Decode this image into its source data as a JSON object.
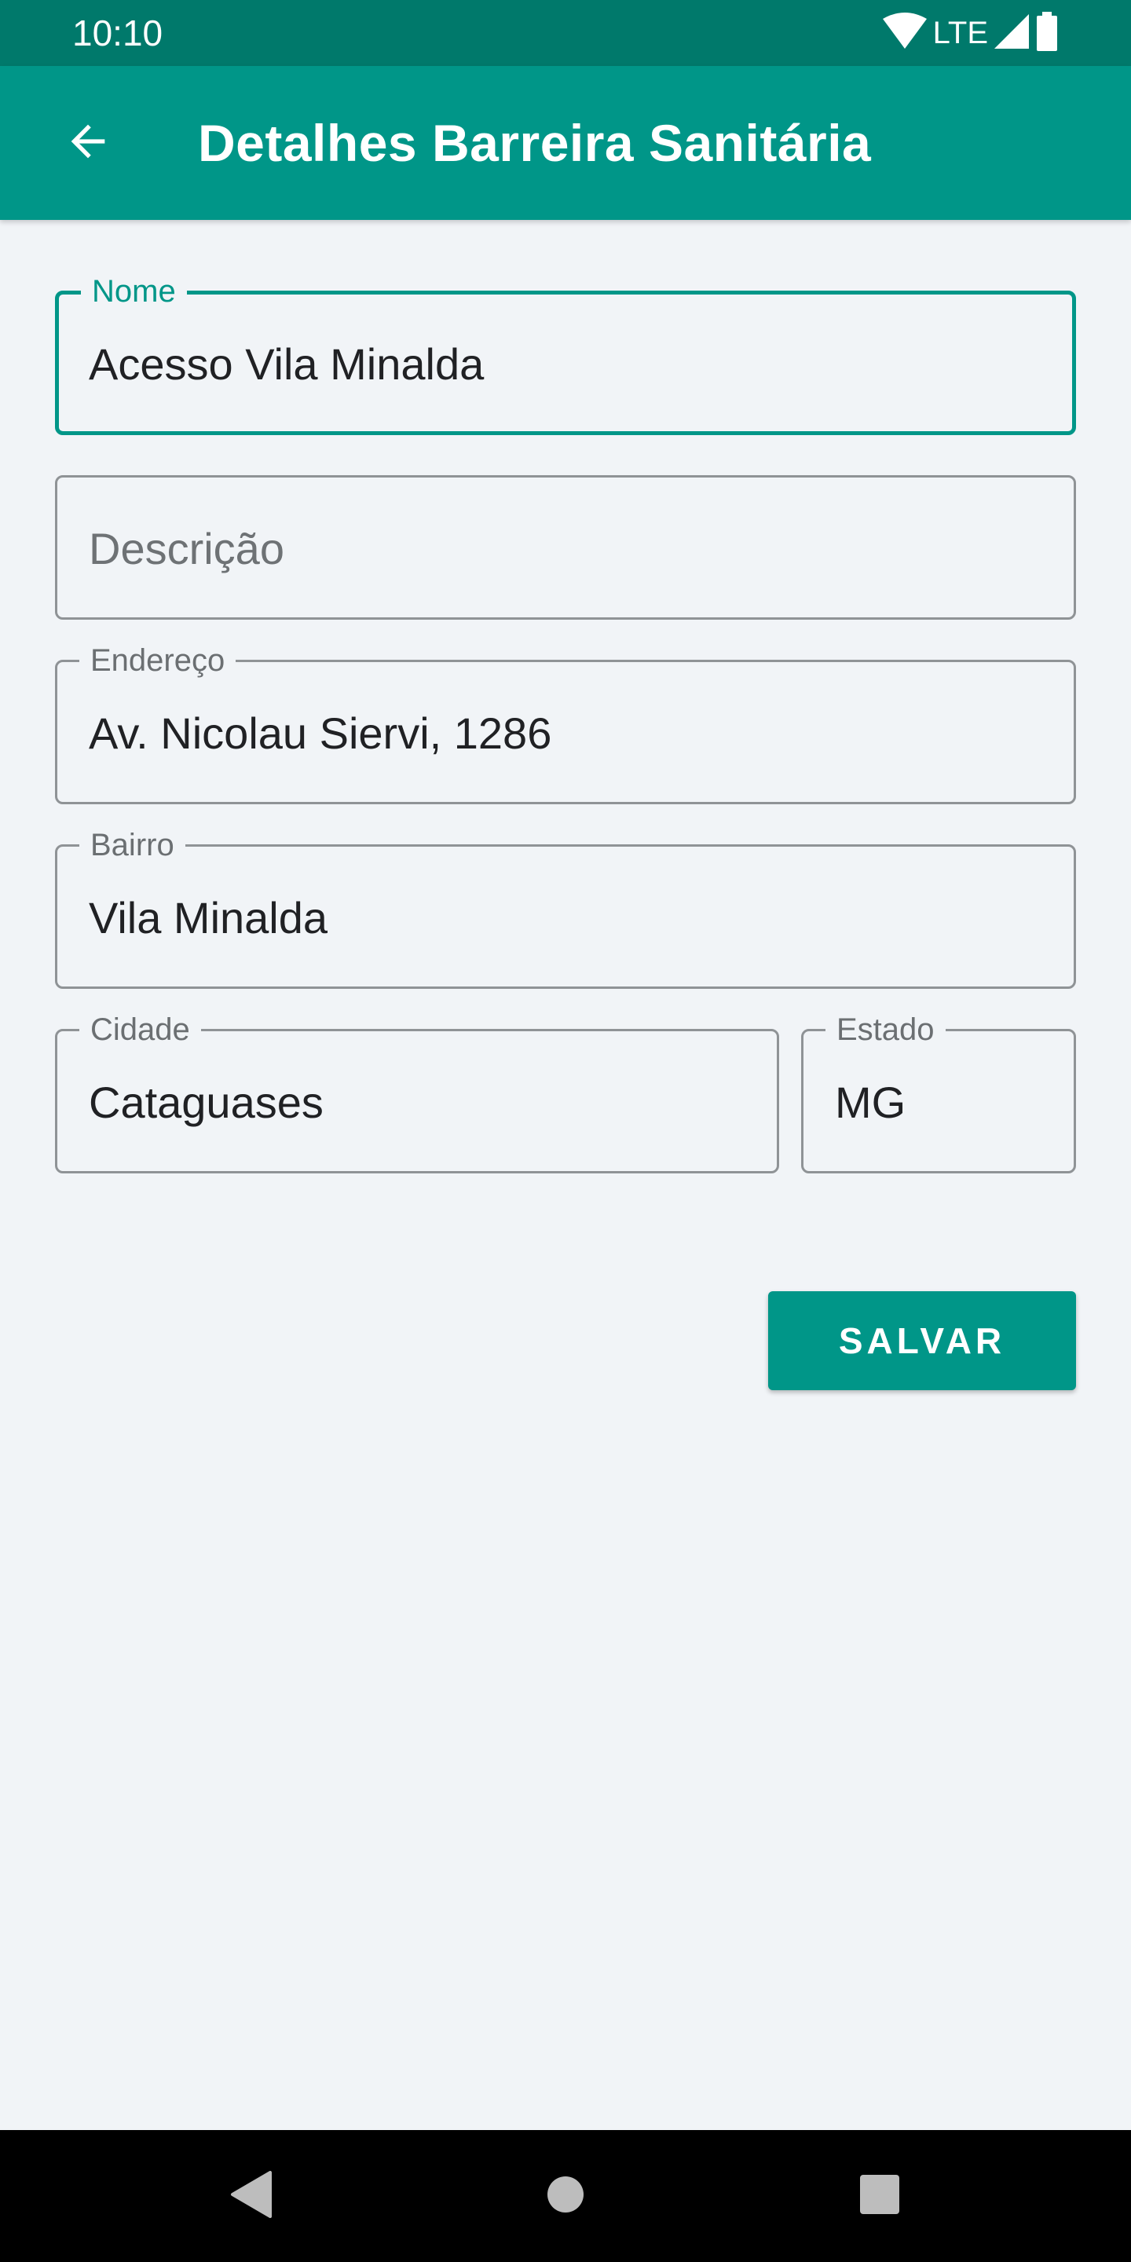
{
  "status_bar": {
    "time": "10:10",
    "network": "LTE"
  },
  "app_bar": {
    "title": "Detalhes Barreira Sanitária",
    "back_icon": "arrow-back-icon"
  },
  "form": {
    "nome": {
      "label": "Nome",
      "value": "Acesso Vila Minalda"
    },
    "descricao": {
      "placeholder": "Descrição",
      "value": ""
    },
    "endereco": {
      "label": "Endereço",
      "value": "Av. Nicolau Siervi, 1286"
    },
    "bairro": {
      "label": "Bairro",
      "value": "Vila Minalda"
    },
    "cidade": {
      "label": "Cidade",
      "value": "Cataguases"
    },
    "estado": {
      "label": "Estado",
      "value": "MG"
    }
  },
  "actions": {
    "save_label": "SALVAR"
  },
  "colors": {
    "primary": "#009688",
    "primary_dark": "#00796b",
    "background": "#f1f4f7"
  }
}
